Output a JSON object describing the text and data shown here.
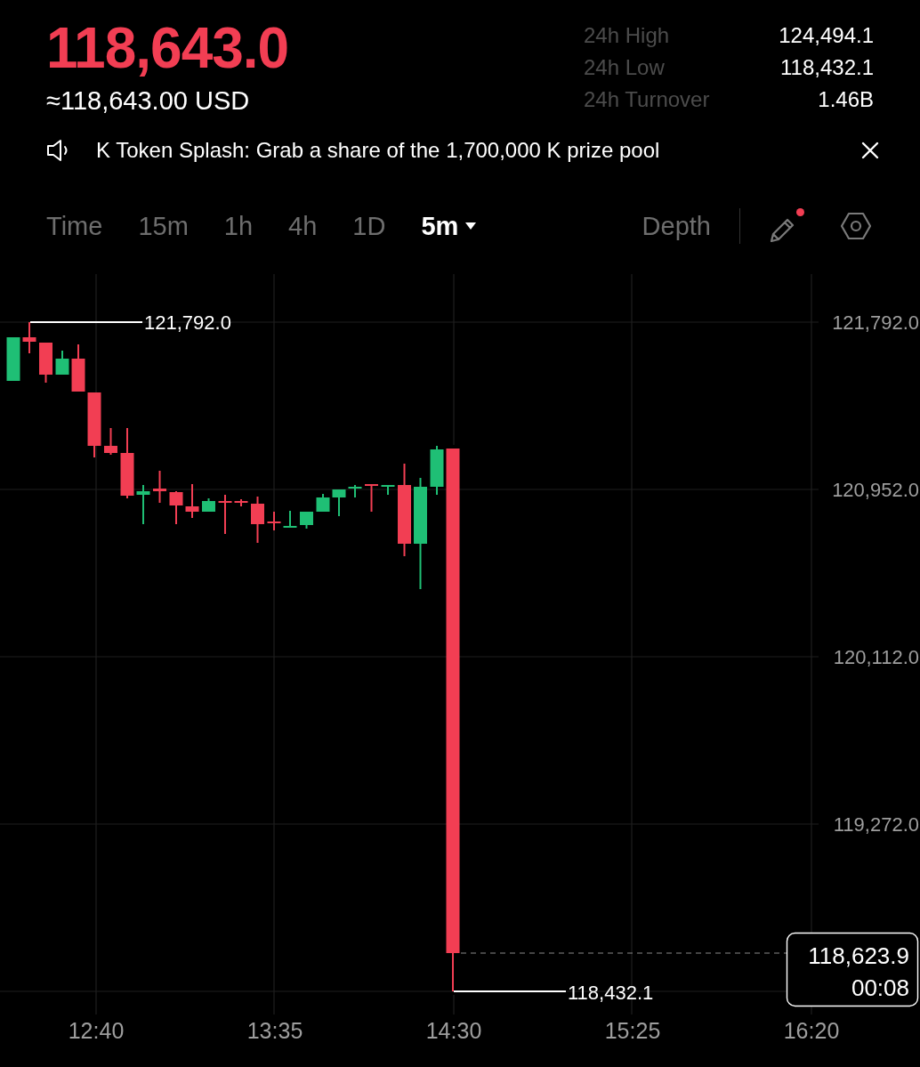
{
  "ticker": {
    "price": "118,643.0",
    "falling": true,
    "fiat_value": "≈118,643.00 USD"
  },
  "stats": [
    {
      "label": "24h High",
      "value": "124,494.1"
    },
    {
      "label": "24h Low",
      "value": "118,432.1"
    },
    {
      "label": "24h Turnover",
      "value": "1.46B"
    }
  ],
  "announcement": {
    "text": "K Token Splash: Grab a share of the 1,700,000 K prize pool"
  },
  "intervals": [
    {
      "label": "Time",
      "selected": false,
      "has_menu": false
    },
    {
      "label": "15m",
      "selected": false,
      "has_menu": false
    },
    {
      "label": "1h",
      "selected": false,
      "has_menu": false
    },
    {
      "label": "4h",
      "selected": false,
      "has_menu": false
    },
    {
      "label": "1D",
      "selected": false,
      "has_menu": false
    },
    {
      "label": "5m",
      "selected": true,
      "has_menu": true
    }
  ],
  "views": [
    {
      "label": "Depth",
      "selected": false
    }
  ],
  "tools": {
    "drawing_alert": true
  },
  "chart": {
    "price_labels": [
      "121,792.0",
      "120,952.0",
      "120,112.0",
      "119,272.0"
    ],
    "time_labels": [
      "12:40",
      "13:35",
      "14:30",
      "15:25",
      "16:20"
    ],
    "high_label": "121,792.0",
    "low_label": "118,432.1",
    "last_price": "118,623.9",
    "countdown": "00:08"
  }
}
